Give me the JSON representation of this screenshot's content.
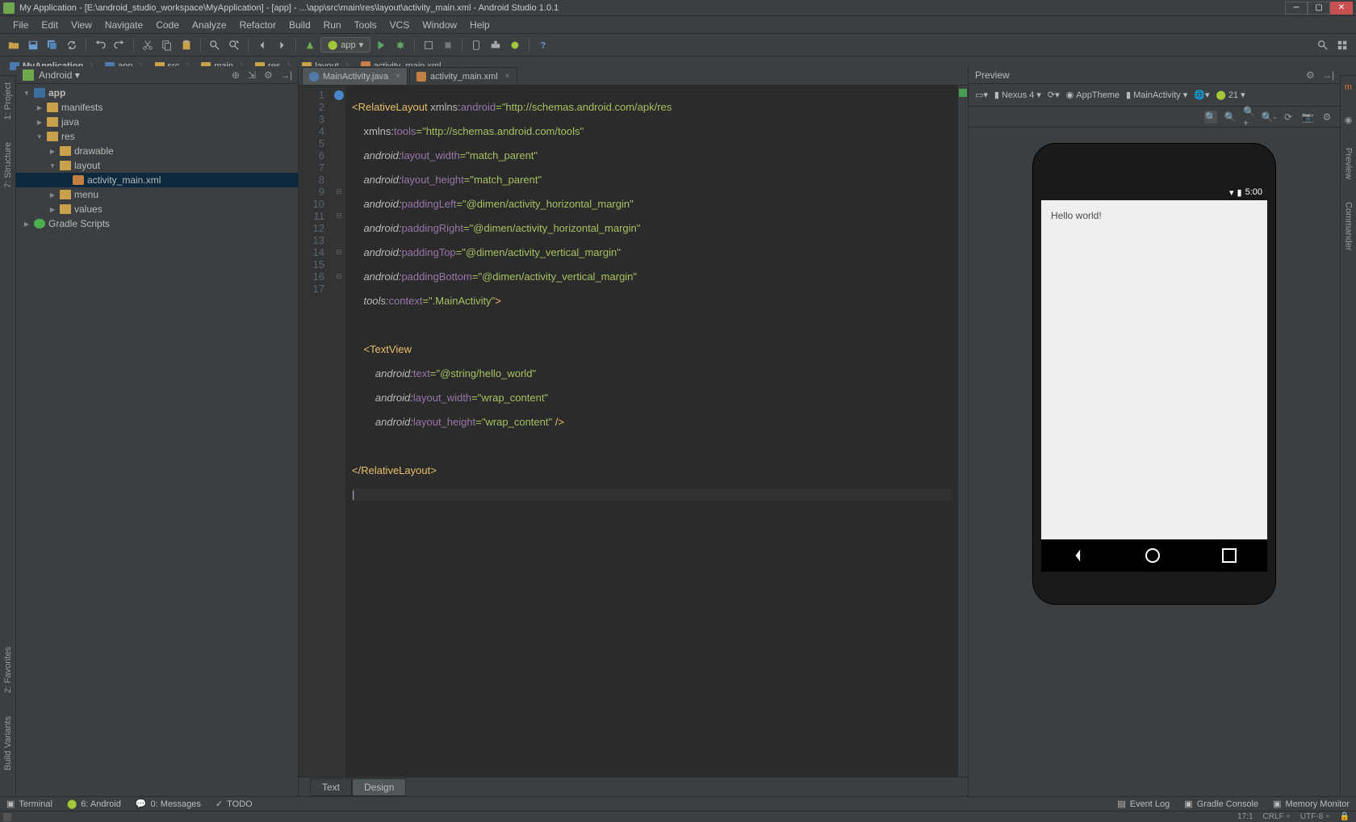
{
  "window": {
    "title": "My Application - [E:\\android_studio_workspace\\MyApplication] - [app] - ...\\app\\src\\main\\res\\layout\\activity_main.xml - Android Studio 1.0.1"
  },
  "menu": [
    "File",
    "Edit",
    "View",
    "Navigate",
    "Code",
    "Analyze",
    "Refactor",
    "Build",
    "Run",
    "Tools",
    "VCS",
    "Window",
    "Help"
  ],
  "breadcrumbs": [
    "MyApplication",
    "app",
    "src",
    "main",
    "res",
    "layout",
    "activity_main.xml"
  ],
  "toolbar": {
    "run_config": "app"
  },
  "side_left": [
    "1: Project",
    "7: Structure"
  ],
  "side_left_bottom": [
    "2: Favorites",
    "Build Variants"
  ],
  "side_right": [
    "Maven Projects",
    "Preview",
    "Commander",
    "Gradle"
  ],
  "project_panel": {
    "mode": "Android",
    "tree": {
      "app": "app",
      "manifests": "manifests",
      "java": "java",
      "res": "res",
      "drawable": "drawable",
      "layout": "layout",
      "activity_main": "activity_main.xml",
      "menu": "menu",
      "values": "values",
      "gradle": "Gradle Scripts"
    }
  },
  "editor_tabs": {
    "tab1": "MainActivity.java",
    "tab2": "activity_main.xml"
  },
  "code": {
    "l1a": "<RelativeLayout ",
    "l1b": "xmlns:",
    "l1c": "android",
    "l1d": "=\"http://schemas.android.com/apk/res",
    "l2a": "xmlns:",
    "l2b": "tools",
    "l2c": "=\"http://schemas.android.com/tools\"",
    "l3a": "android:",
    "l3b": "layout_width",
    "l3c": "=\"match_parent\"",
    "l4a": "android:",
    "l4b": "layout_height",
    "l4c": "=\"match_parent\"",
    "l5a": "android:",
    "l5b": "paddingLeft",
    "l5c": "=\"@dimen/activity_horizontal_margin\"",
    "l6a": "android:",
    "l6b": "paddingRight",
    "l6c": "=\"@dimen/activity_horizontal_margin\"",
    "l7a": "android:",
    "l7b": "paddingTop",
    "l7c": "=\"@dimen/activity_vertical_margin\"",
    "l8a": "android:",
    "l8b": "paddingBottom",
    "l8c": "=\"@dimen/activity_vertical_margin\"",
    "l9a": "tools:",
    "l9b": "context",
    "l9c": "=\".MainActivity\"",
    "l9d": ">",
    "l11": "<TextView",
    "l12a": "android:",
    "l12b": "text",
    "l12c": "=\"@string/hello_world\"",
    "l13a": "android:",
    "l13b": "layout_width",
    "l13c": "=\"wrap_content\"",
    "l14a": "android:",
    "l14b": "layout_height",
    "l14c": "=\"wrap_content\" ",
    "l14d": "/>",
    "l16": "</RelativeLayout>"
  },
  "line_numbers": [
    "1",
    "2",
    "3",
    "4",
    "5",
    "6",
    "7",
    "8",
    "9",
    "10",
    "11",
    "12",
    "13",
    "14",
    "15",
    "16",
    "17"
  ],
  "editor_bottom": {
    "text": "Text",
    "design": "Design"
  },
  "preview": {
    "title": "Preview",
    "device": "Nexus 4",
    "theme": "AppTheme",
    "activity": "MainActivity",
    "api": "21",
    "status_time": "5:00",
    "hello": "Hello world!"
  },
  "bottom_bar": {
    "terminal": "Terminal",
    "android": "6: Android",
    "messages": "0: Messages",
    "todo": "TODO",
    "event_log": "Event Log",
    "gradle_console": "Gradle Console",
    "memory": "Memory Monitor"
  },
  "status": {
    "pos": "17:1",
    "lf": "CRLF",
    "enc": "UTF-8"
  }
}
